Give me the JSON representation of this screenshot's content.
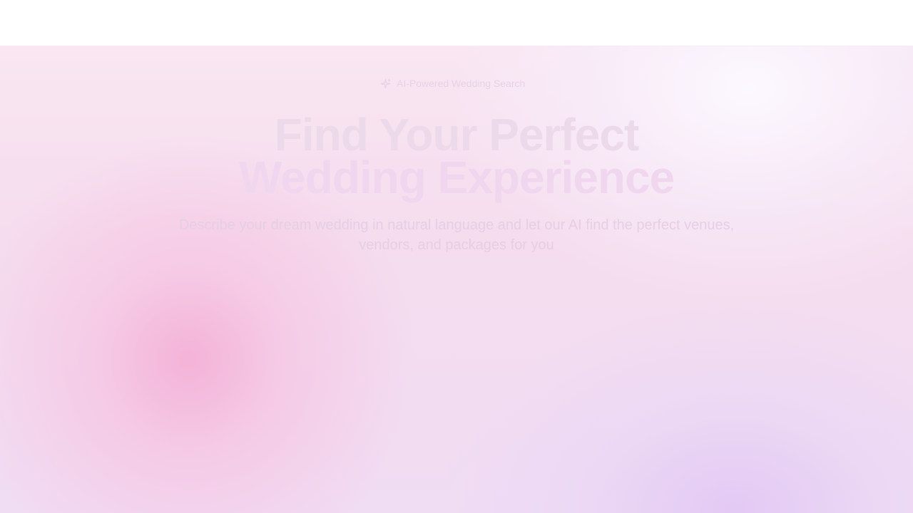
{
  "header": {},
  "hero": {
    "badge": {
      "icon": "sparkle-icon",
      "label": "AI-Powered Wedding Search"
    },
    "title_line1": "Find Your Perfect",
    "title_line2": "Wedding Experience",
    "subtitle": "Describe your dream wedding in natural language and let our AI find the perfect venues, vendors, and packages for you"
  },
  "colors": {
    "pink_glow": "#f4b0d6",
    "lavender_glow": "#e2c8f4",
    "title_text": "#ecd9e9",
    "accent_text": "#f1d6ef"
  }
}
